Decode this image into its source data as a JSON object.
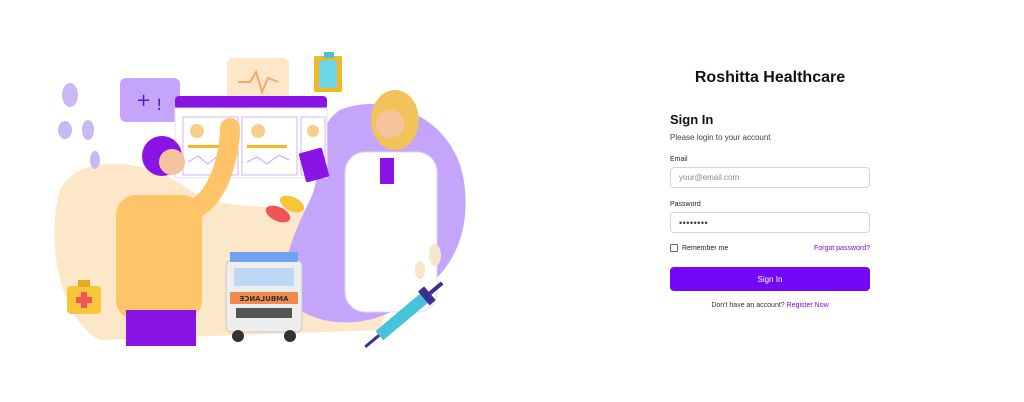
{
  "brand": {
    "title": "Roshitta Healthcare"
  },
  "login": {
    "heading": "Sign In",
    "subheading": "Please login to your account",
    "email": {
      "label": "Email",
      "placeholder": "your@email.com"
    },
    "password": {
      "label": "Password",
      "value": "••••••••"
    },
    "remember_label": "Remember me",
    "forgot_label": "Forgot password?",
    "submit_label": "Sign In",
    "register_prompt": "Don't have an account?",
    "register_label": "Register Now"
  },
  "illustration": {
    "ambulance_text": "AMBULANCE"
  },
  "colors": {
    "accent": "#7407f7",
    "link": "#7d0bd8",
    "illustration_purple": "#c5a4fb",
    "illustration_cream": "#fde7c9"
  }
}
